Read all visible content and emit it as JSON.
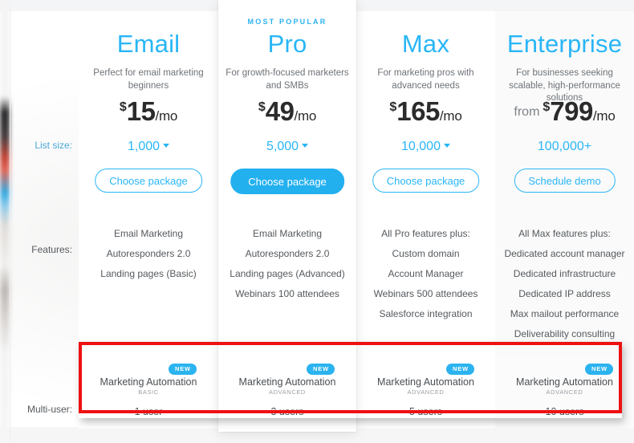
{
  "label_column": {
    "list_size": "List size:",
    "features": "Features:",
    "multi_user": "Multi-user:"
  },
  "badges": {
    "most_popular": "MOST POPULAR",
    "new": "NEW"
  },
  "accent_colors": {
    "brand_blue": "#29b6f6",
    "filled_button": "#22b0ef",
    "annotation_red": "#ee1111",
    "body_text": "#55595d"
  },
  "plans": [
    {
      "key": "email",
      "name": "Email",
      "description": "Perfect for email marketing beginners",
      "price_from": "",
      "price_currency": "$",
      "price_amount": "15",
      "price_period": "/mo",
      "list_size": "1,000",
      "list_size_has_caret": true,
      "cta": "Choose package",
      "cta_style": "outline",
      "features": [
        "Email Marketing",
        "Autoresponders 2.0",
        "Landing pages (Basic)"
      ],
      "automation_title": "Marketing Automation",
      "automation_tier": "BASIC",
      "automation_new": "NEW",
      "users": "1 user",
      "most_popular": false
    },
    {
      "key": "pro",
      "name": "Pro",
      "description": "For growth-focused marketers and SMBs",
      "price_from": "",
      "price_currency": "$",
      "price_amount": "49",
      "price_period": "/mo",
      "list_size": "5,000",
      "list_size_has_caret": true,
      "cta": "Choose package",
      "cta_style": "filled",
      "features": [
        "Email Marketing",
        "Autoresponders 2.0",
        "Landing pages (Advanced)",
        "Webinars 100 attendees"
      ],
      "automation_title": "Marketing Automation",
      "automation_tier": "ADVANCED",
      "automation_new": "NEW",
      "users": "3 users",
      "most_popular": true
    },
    {
      "key": "max",
      "name": "Max",
      "description": "For marketing pros with advanced needs",
      "price_from": "",
      "price_currency": "$",
      "price_amount": "165",
      "price_period": "/mo",
      "list_size": "10,000",
      "list_size_has_caret": true,
      "cta": "Choose package",
      "cta_style": "outline",
      "features": [
        "All Pro features plus:",
        "Custom domain",
        "Account Manager",
        "Webinars 500 attendees",
        "Salesforce integration"
      ],
      "automation_title": "Marketing Automation",
      "automation_tier": "ADVANCED",
      "automation_new": "NEW",
      "users": "5 users",
      "most_popular": false
    },
    {
      "key": "enterprise",
      "name": "Enterprise",
      "description": "For businesses seeking scalable, high-performance solutions",
      "price_from": "from",
      "price_currency": "$",
      "price_amount": "799",
      "price_period": "/mo",
      "list_size": "100,000+",
      "list_size_has_caret": false,
      "cta": "Schedule demo",
      "cta_style": "outline",
      "features": [
        "All Max features plus:",
        "Dedicated account manager",
        "Dedicated infrastructure",
        "Dedicated IP address",
        "Max mailout performance",
        "Deliverability consulting"
      ],
      "automation_title": "Marketing Automation",
      "automation_tier": "ADVANCED",
      "automation_new": "NEW",
      "users": "10 users",
      "most_popular": false
    }
  ]
}
